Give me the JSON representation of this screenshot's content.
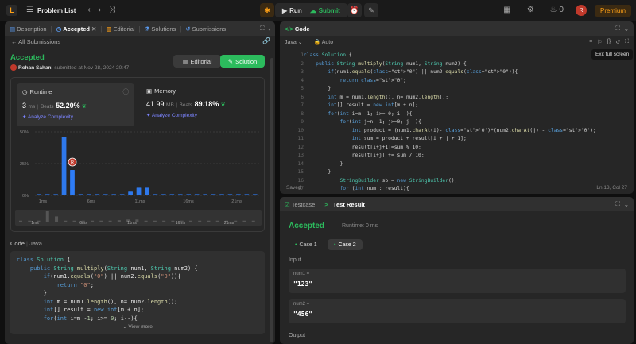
{
  "topbar": {
    "title": "Problem List",
    "run": "Run",
    "submit": "Submit",
    "fire": "0",
    "avatar": "R",
    "premium": "Premium"
  },
  "left": {
    "tabs": [
      "Description",
      "Accepted",
      "Editorial",
      "Solutions",
      "Submissions"
    ],
    "back": "All Submissions",
    "status": "Accepted",
    "user": "Rohan Sahani",
    "submitted": "submitted at Nov 28, 2024 20:47",
    "editorial_btn": "Editorial",
    "solution_btn": "Solution",
    "runtime": {
      "label": "Runtime",
      "value": "3",
      "unit": "ms",
      "beats_label": "Beats",
      "beats": "52.20%",
      "analyze": "Analyze Complexity"
    },
    "memory": {
      "label": "Memory",
      "value": "41.99",
      "unit": "MB",
      "beats_label": "Beats",
      "beats": "89.18%",
      "analyze": "Analyze Complexity"
    },
    "code_label": "Code",
    "code_lang": "Java",
    "code_preview": [
      "class Solution {",
      "    public String multiply(String num1, String num2) {",
      "        if(num1.equals(\"0\") || num2.equals(\"0\")){",
      "            return \"0\";",
      "        }",
      "        int m = num1.length(), n= num2.length();",
      "        int[] result = new int[m + n];",
      "        for(int i=m -1; i>= 0; i--){"
    ],
    "view_more": "View more"
  },
  "chart_data": {
    "type": "bar",
    "ytick_labels": [
      "50%",
      "25%",
      "0%"
    ],
    "xtick_labels": [
      "1ms",
      "6ms",
      "11ms",
      "16ms",
      "21ms"
    ],
    "mini_labels": [
      "1ms",
      "6ms",
      "11ms",
      "16ms",
      "21ms"
    ],
    "ylim": [
      0,
      50
    ],
    "values": [
      1,
      1,
      1,
      46,
      20,
      1,
      1,
      1,
      1,
      1,
      1,
      3,
      6,
      6,
      1,
      1,
      1,
      1,
      1,
      1,
      1,
      1,
      1,
      1,
      1,
      1,
      1
    ],
    "highlight_index": 4,
    "marker_label": "R"
  },
  "editor": {
    "title": "Code",
    "lang": "Java",
    "auto": "Auto",
    "tooltip": "Exit full screen",
    "saved": "Saved",
    "cursor": "Ln 13, Col 27",
    "lines": [
      "class Solution {",
      "    public String multiply(String num1, String num2) {",
      "        if(num1.equals(\"0\") || num2.equals(\"0\")){",
      "            return \"0\";",
      "        }",
      "        int m = num1.length(), n= num2.length();",
      "        int[] result = new int[m + n];",
      "        for(int i=m -1; i>= 0; i--){",
      "            for(int j=n -1; j>=0; j--){",
      "                int product = (num1.charAt(i)- '0')*(num2.charAt(j) - '0');",
      "                int sum = product + result[i + j + 1];",
      "                result[i+j+1]=sum % 10;",
      "                result[i+j] += sum / 10;",
      "            }",
      "        }",
      "            StringBuilder sb = new StringBuilder();",
      "            for (int num : result){"
    ]
  },
  "result": {
    "tab_testcase": "Testcase",
    "tab_result": "Test Result",
    "status": "Accepted",
    "runtime": "Runtime: 0 ms",
    "case1": "Case 1",
    "case2": "Case 2",
    "input": "Input",
    "num1_label": "num1 =",
    "num1": "\"123\"",
    "num2_label": "num2 =",
    "num2": "\"456\"",
    "output": "Output"
  }
}
